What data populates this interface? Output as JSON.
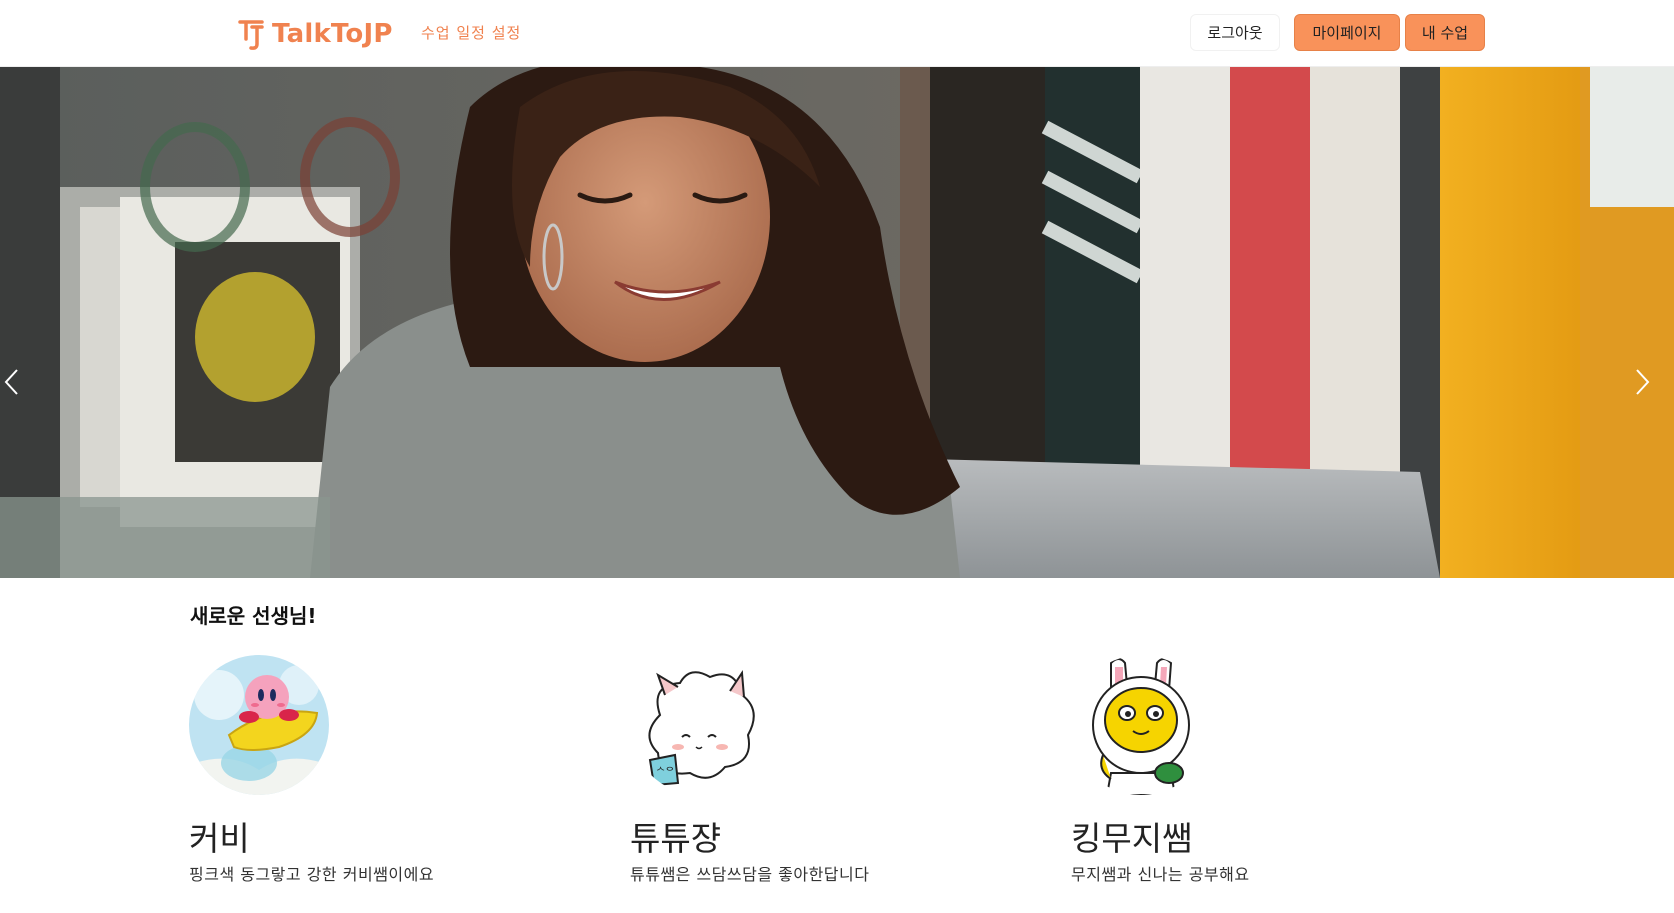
{
  "header": {
    "brand_text": "TalkToJP",
    "nav_link": "수업 일정 설정",
    "logout_label": "로그아웃",
    "mypage_label": "마이페이지",
    "myclass_label": "내 수업"
  },
  "colors": {
    "accent": "#f0824f",
    "button_fill": "#f9925a"
  },
  "hero": {
    "prev_icon": "chevron-left-icon",
    "next_icon": "chevron-right-icon"
  },
  "teachers_section": {
    "title": "새로운 선생님!",
    "teachers": [
      {
        "name": "커비",
        "description": "핑크색 동그랗고 강한 커비쌤이에요",
        "avatar": "kirby-avatar"
      },
      {
        "name": "튜튜쟝",
        "description": "튜튜쌤은 쓰담쓰담을 좋아한답니다",
        "avatar": "sheep-avatar"
      },
      {
        "name": "킹무지쌤",
        "description": "무지쌤과 신나는 공부해요",
        "avatar": "muji-avatar"
      }
    ]
  }
}
